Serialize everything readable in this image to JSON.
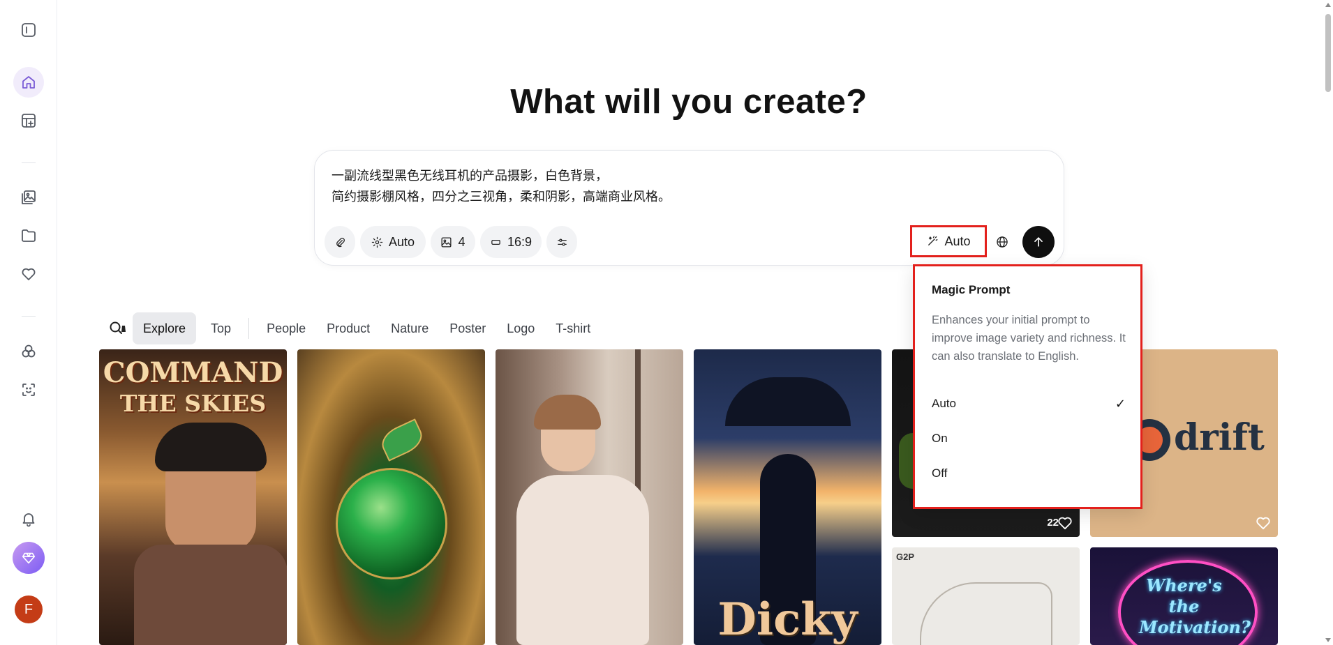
{
  "headline": "What will you create?",
  "prompt": {
    "line1": "一副流线型黑色无线耳机的产品摄影，白色背景，",
    "line2": "简约摄影棚风格，四分之三视角，柔和阴影，高端商业风格。"
  },
  "toolbar": {
    "style_label": "Auto",
    "image_count": "4",
    "aspect_ratio": "16:9",
    "magic_label": "Auto"
  },
  "filters": {
    "items": [
      "Explore",
      "Top",
      "People",
      "Product",
      "Nature",
      "Poster",
      "Logo",
      "T-shirt"
    ],
    "active": "Explore"
  },
  "dropdown": {
    "title": "Magic Prompt",
    "description": "Enhances your initial prompt to improve image variety and richness. It can also translate to English.",
    "options": [
      "Auto",
      "On",
      "Off"
    ],
    "selected": "Auto"
  },
  "cards": {
    "card1_title1": "COMMAND",
    "card1_title2": "THE SKIES",
    "card4_title": "Dicky",
    "card5_likes": "22",
    "card6_logo": "drift",
    "card7_label": "G2P",
    "card8_title": "Where's the Motivation?"
  },
  "user": {
    "initial": "F"
  },
  "colors": {
    "accent_purple": "#7b5cd6",
    "highlight_red": "#e3201c",
    "avatar_orange": "#c43c16"
  }
}
